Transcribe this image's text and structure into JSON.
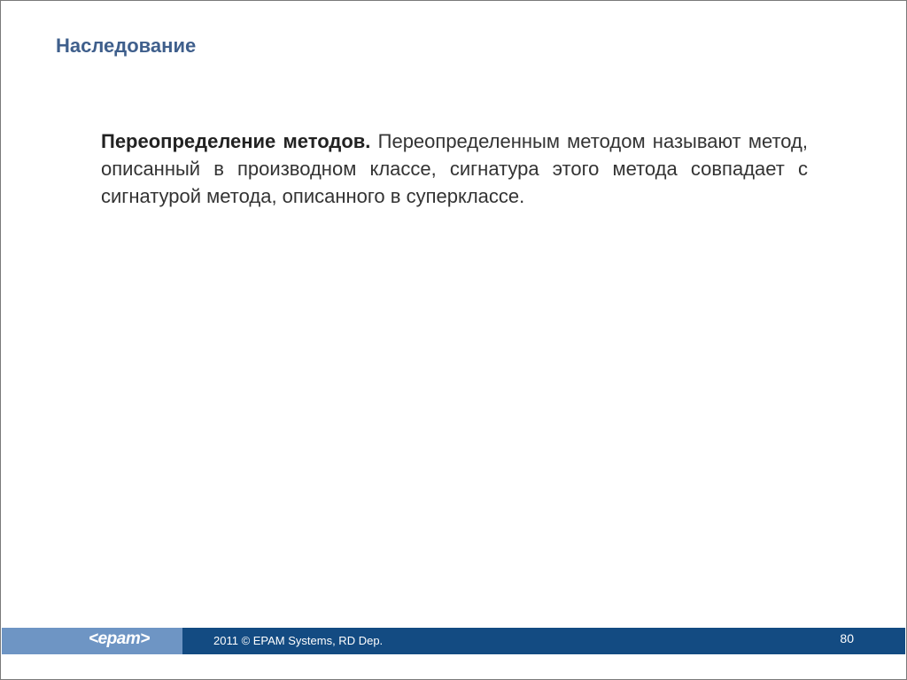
{
  "slide": {
    "title": "Наследование",
    "paragraph": {
      "term": "Переопределение методов.",
      "text": " Переопределенным методом называют метод, описанный в производном классе, сигнатура этого метода совпадает с сигнатурой метода, описанного в суперклассе."
    }
  },
  "footer": {
    "logo": "<epam>",
    "copyright": "2011 © EPAM Systems, RD Dep.",
    "page_number": "80"
  },
  "colors": {
    "title": "#3f5f8c",
    "footer_bar": "#134b82",
    "footer_logo_bg": "#6e95c4"
  }
}
